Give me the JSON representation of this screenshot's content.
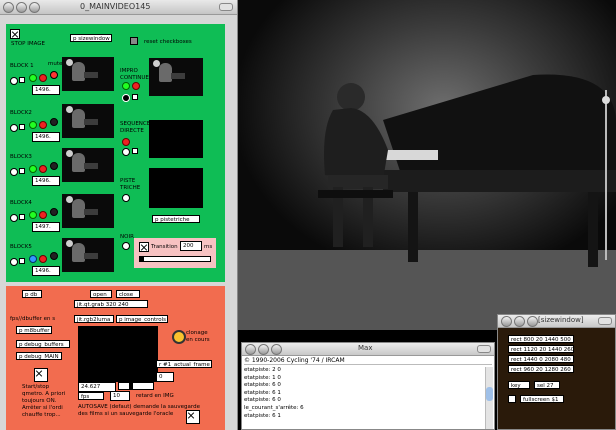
{
  "patcher": {
    "title": "0_MAINVIDEO145",
    "stop_image": "STOP IMAGE",
    "sizewindow": "p sizewindow",
    "reset_checkboxes": "reset checkboxes",
    "mute": "mute",
    "blocks": [
      {
        "label": "BLOCK 1",
        "value": "1496."
      },
      {
        "label": "BLOCK2",
        "value": "1496."
      },
      {
        "label": "BLOCK3",
        "value": "1496."
      },
      {
        "label": "BLOCK4",
        "value": "1497."
      },
      {
        "label": "BLOCK5",
        "value": "1496."
      }
    ],
    "impro": "IMPRO\nCONTINUE",
    "sequence": "SEQUENCE\nDIRECTE",
    "piste": "PISTE\nTRICHE",
    "pistetriche": "p pistetriche",
    "noir": "NOIR",
    "transition_label": "Transition",
    "transition_value": "200",
    "transition_unit": "ms",
    "db": "p db",
    "open": "open",
    "close": "close",
    "grab": "jit.qt.grab 320 240",
    "fps_label": "fps//dbuffer en s",
    "dbuffer": "p m8buffer",
    "debug_buffers": "p debug_buffers",
    "debug_main": "p debug_MAIN",
    "rgb2luma": "jit.rgb2luma",
    "image_controls": "p image_controls",
    "clonage": "clonage\nen cours",
    "actual_frame": "r #1_actual_frame",
    "start_stop": "Start/stop\nqmetro. A priori\ntoujours ON.\nArrêter si l'ordi\nchauffe trop...",
    "fps_value": "24.627",
    "fps_box": "fps",
    "retard_value": "10",
    "retard_label": "retard en IMG",
    "zero_box": "0",
    "autosave": "AUTOSAVE (defaut) demande la sauvegarde\ndes films si un sauvegarde l'oracle"
  },
  "max_window": {
    "title": "Max",
    "header": "© 1990-2006 Cycling '74 / IRCAM",
    "lines": [
      "etatpiste: 2 0",
      "etatpiste: 1 0",
      "etatpiste: 6 0",
      "etatpiste: 6 1",
      "etatpiste: 6 0",
      "le_courant_s'arrête: 6",
      "etatpiste: 6 1"
    ]
  },
  "sizewindow": {
    "title": "[sizewindow]",
    "rects": [
      "rect 800 20 1440 500",
      "rect 1120 20 1440 260",
      "rect 1440 0 2080 480",
      "rect 960 20 1280 260"
    ],
    "key": "key",
    "sel": "sel 27",
    "fullscreen": "fullscreen $1"
  }
}
